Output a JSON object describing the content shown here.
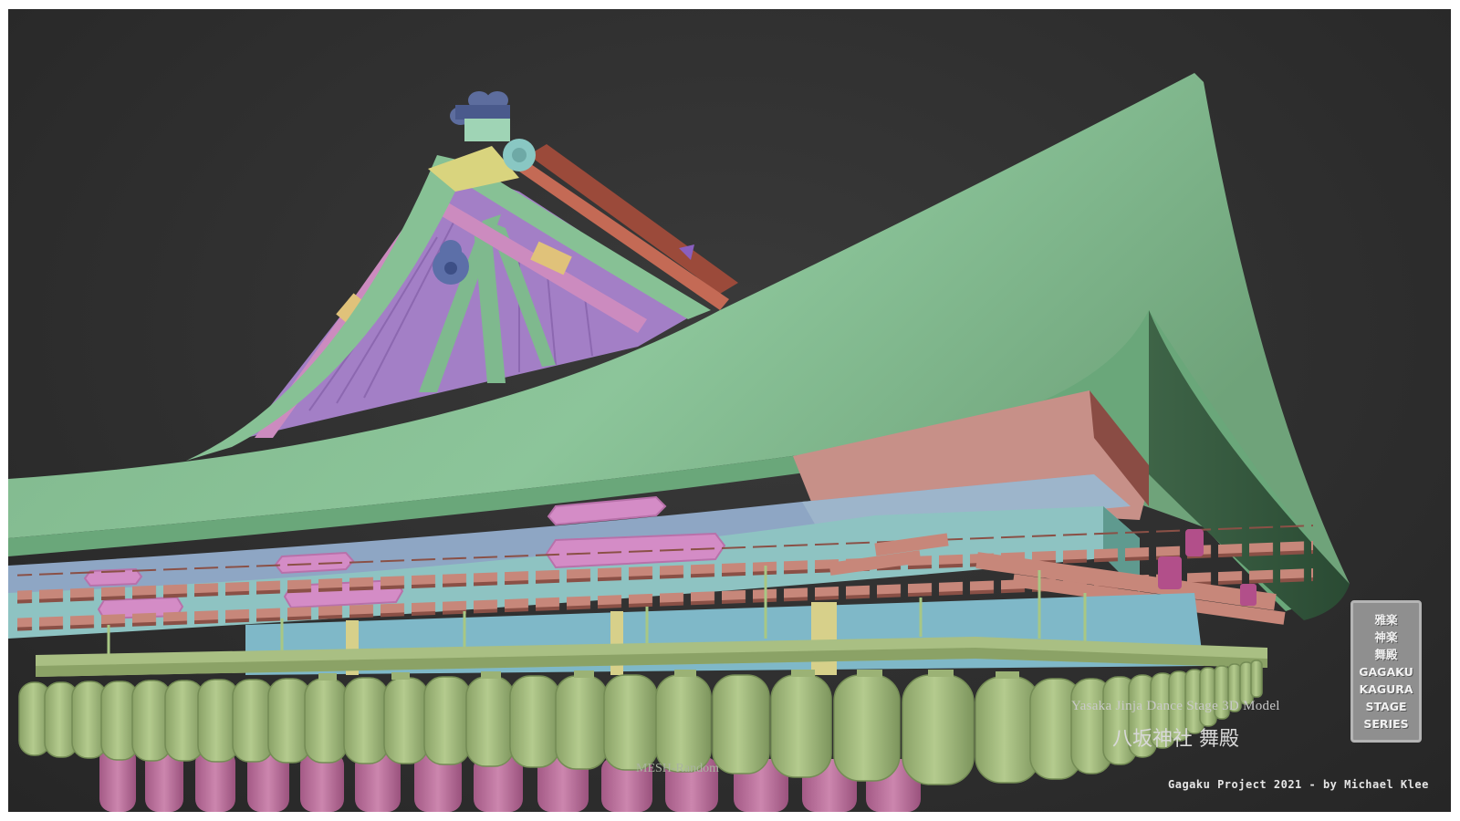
{
  "caption": {
    "title_en": "Yasaka Jinja Dance Stage 3D Model",
    "title_jp": "八坂神社 舞殿",
    "render_mode": "MESH-Random"
  },
  "credit": "Gagaku Project 2021 - by Michael Klee",
  "badge": {
    "lines": [
      "雅楽",
      "神楽",
      "舞殿",
      "GAGAKU",
      "KAGURA",
      "STAGE",
      "SERIES"
    ]
  },
  "colors": {
    "background": "#333333",
    "roof_green": "#86c296",
    "beam_pink": "#c58f82",
    "beam_blue": "#8ea8c3",
    "gable_purple": "#a580c6",
    "lantern_green": "#a9bf83",
    "lantern_pink": "#c47aa5"
  }
}
